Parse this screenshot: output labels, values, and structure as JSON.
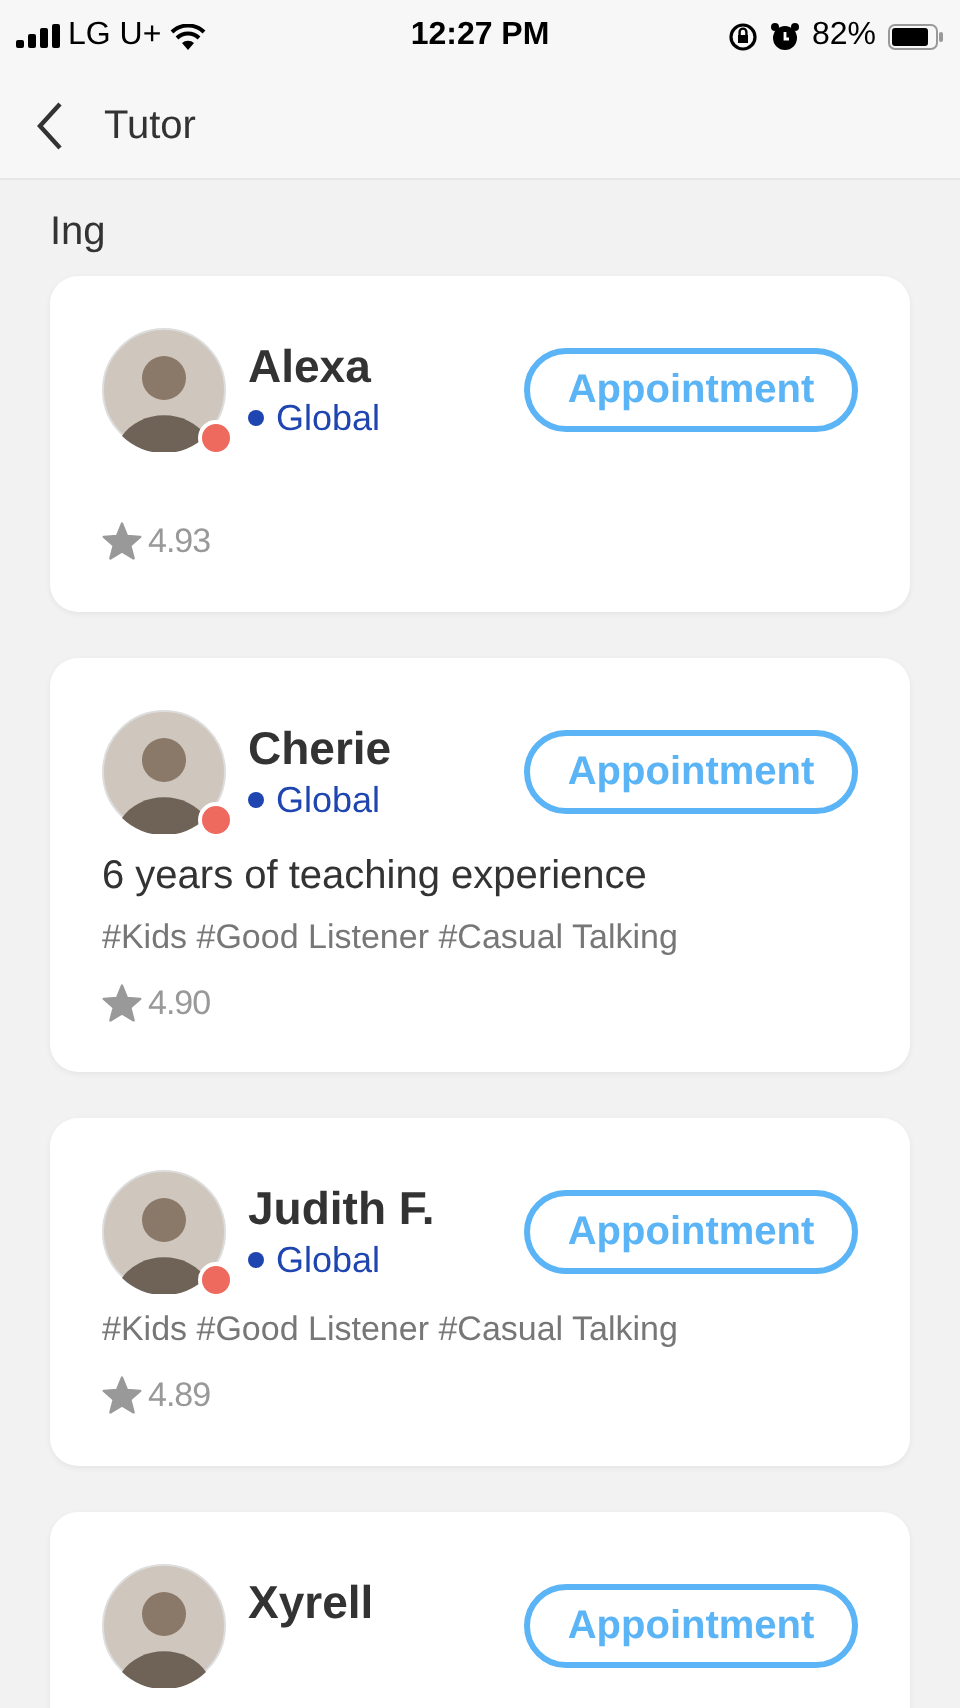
{
  "status_bar": {
    "carrier": "LG U+",
    "time": "12:27 PM",
    "battery": "82%"
  },
  "header": {
    "title": "Tutor"
  },
  "section": {
    "title": "Ing"
  },
  "tutors": [
    {
      "name": "Alexa",
      "online": false,
      "region": "Global",
      "button": "Appointment",
      "rating": "4.93"
    },
    {
      "name": "Cherie",
      "online": false,
      "region": "Global",
      "button": "Appointment",
      "intro": "6 years of teaching experience",
      "tags": "#Kids #Good Listener #Casual Talking",
      "rating": "4.90"
    },
    {
      "name": "Judith F.",
      "online": false,
      "region": "Global",
      "button": "Appointment",
      "tags": "#Kids #Good Listener #Casual Talking",
      "rating": "4.89"
    },
    {
      "name": "Xyrell",
      "button": "Appointment"
    }
  ]
}
